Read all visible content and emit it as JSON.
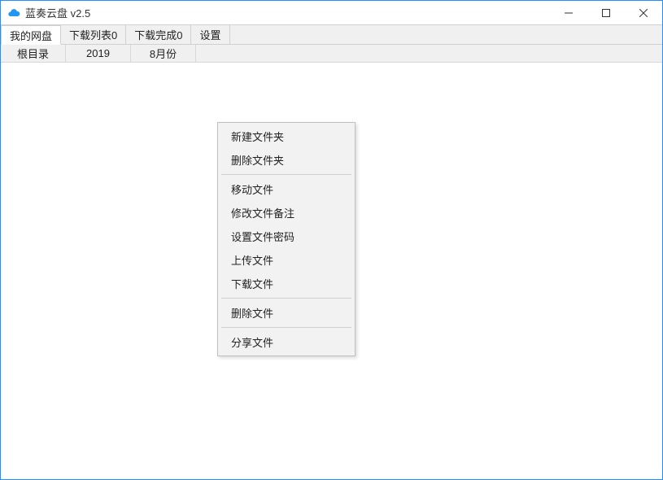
{
  "window": {
    "title": "蓝奏云盘 v2.5"
  },
  "tabs": [
    {
      "label": "我的网盘"
    },
    {
      "label": "下载列表0"
    },
    {
      "label": "下载完成0"
    },
    {
      "label": "设置"
    }
  ],
  "breadcrumbs": [
    {
      "label": "根目录"
    },
    {
      "label": "2019"
    },
    {
      "label": "8月份"
    }
  ],
  "context_menu": {
    "groups": [
      [
        {
          "label": "新建文件夹"
        },
        {
          "label": "删除文件夹"
        }
      ],
      [
        {
          "label": "移动文件"
        },
        {
          "label": "修改文件备注"
        },
        {
          "label": "设置文件密码"
        },
        {
          "label": "上传文件"
        },
        {
          "label": "下载文件"
        }
      ],
      [
        {
          "label": "删除文件"
        }
      ],
      [
        {
          "label": "分享文件"
        }
      ]
    ]
  }
}
